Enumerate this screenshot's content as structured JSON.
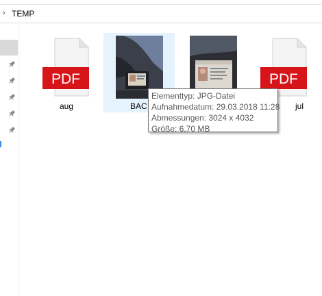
{
  "breadcrumb": {
    "chevron": "›",
    "folder": "TEMP"
  },
  "files": [
    {
      "name": "aug",
      "type_badge": "PDF"
    },
    {
      "name": "BAC"
    },
    {
      "name": ""
    },
    {
      "name": "jul",
      "type_badge": "PDF"
    }
  ],
  "tooltip": {
    "type": "Elementtyp: JPG-Datei",
    "date": "Aufnahmedatum: 29.03.2018 11:28",
    "dimensions": "Abmessungen: 3024 x 4032",
    "size": "Größe: 6,70 MB"
  },
  "icons": [
    "chevron-right-icon",
    "pin-icon",
    "pdf-file-icon",
    "image-thumbnail"
  ],
  "colors": {
    "pdf_red": "#d7141a",
    "hover_bg": "#e5f3ff",
    "selected_nav": "#d9d9d9"
  }
}
